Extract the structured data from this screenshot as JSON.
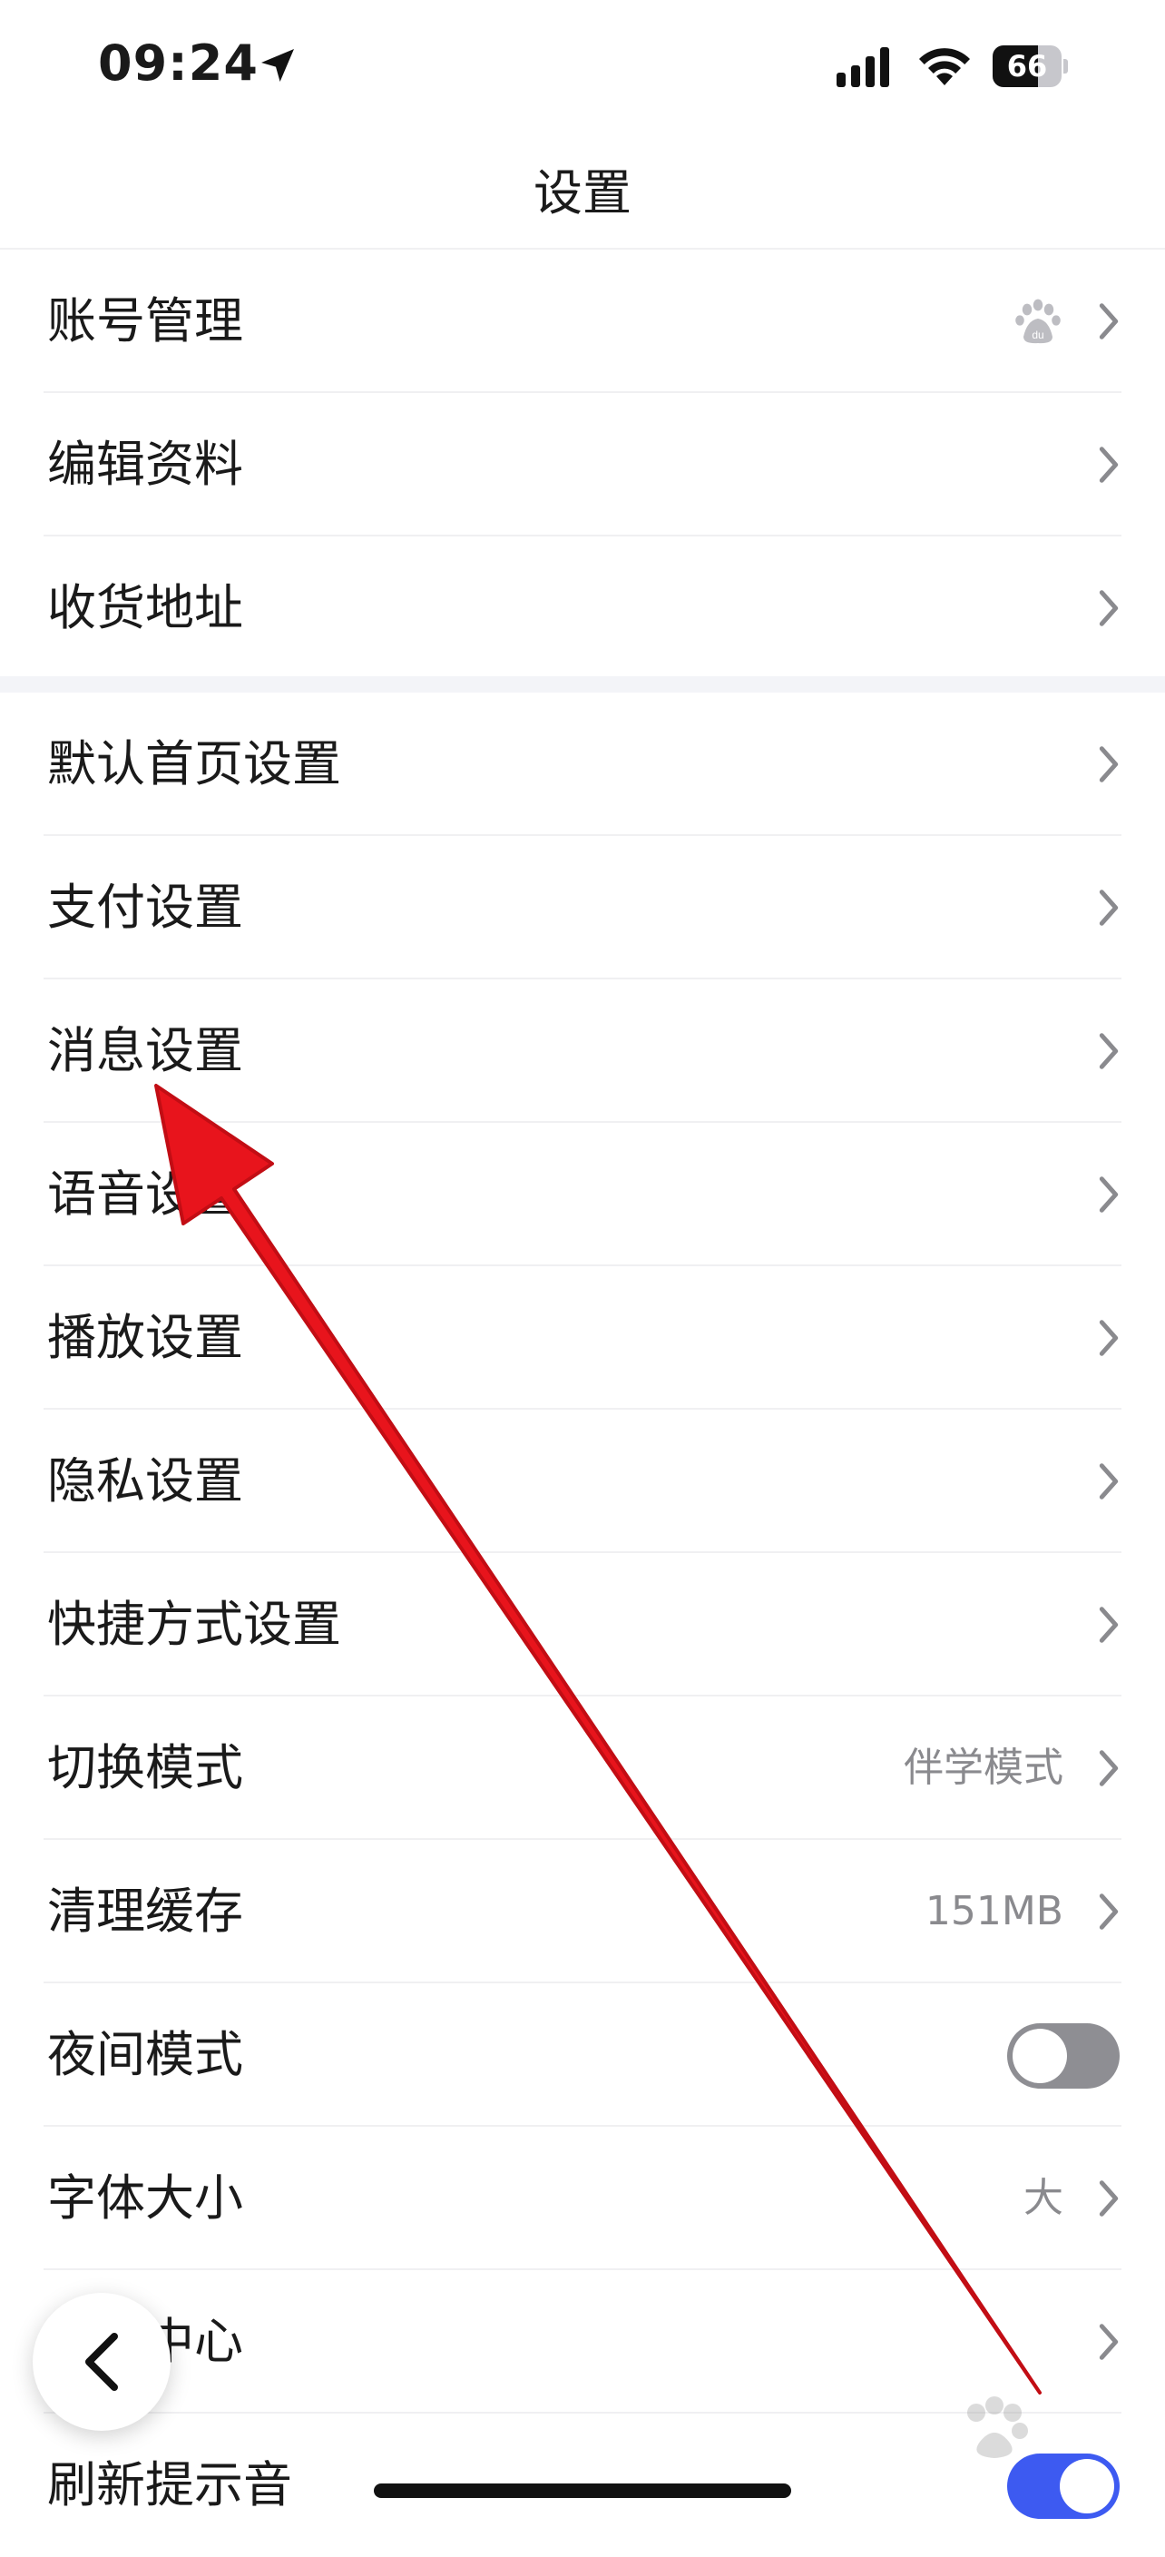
{
  "status_bar": {
    "time": "09:24",
    "battery": "66",
    "battery_level": 0.66
  },
  "nav": {
    "title": "设置"
  },
  "groups": [
    {
      "items": [
        {
          "label": "账号管理",
          "trailing_icon": "baidu-paw-icon"
        },
        {
          "label": "编辑资料"
        },
        {
          "label": "收货地址"
        }
      ]
    },
    {
      "items": [
        {
          "label": "默认首页设置"
        },
        {
          "label": "支付设置"
        },
        {
          "label": "消息设置"
        },
        {
          "label": "语音设置"
        },
        {
          "label": "播放设置"
        },
        {
          "label": "隐私设置"
        },
        {
          "label": "快捷方式设置"
        },
        {
          "label": "切换模式",
          "value": "伴学模式"
        },
        {
          "label": "清理缓存",
          "value": "151MB"
        },
        {
          "label": "夜间模式",
          "toggle": false
        },
        {
          "label": "字体大小",
          "value": "大"
        },
        {
          "label": "装扮中心"
        },
        {
          "label": "刷新提示音",
          "toggle": true
        }
      ]
    }
  ],
  "colors": {
    "accent": "#3d5af1",
    "annotation_arrow": "#e8141c",
    "toggle_off": "#8e8e93",
    "secondary_text": "#8a8a8e"
  },
  "icons": {
    "back": "chevron-left-icon",
    "row_arrow": "chevron-right-icon"
  }
}
